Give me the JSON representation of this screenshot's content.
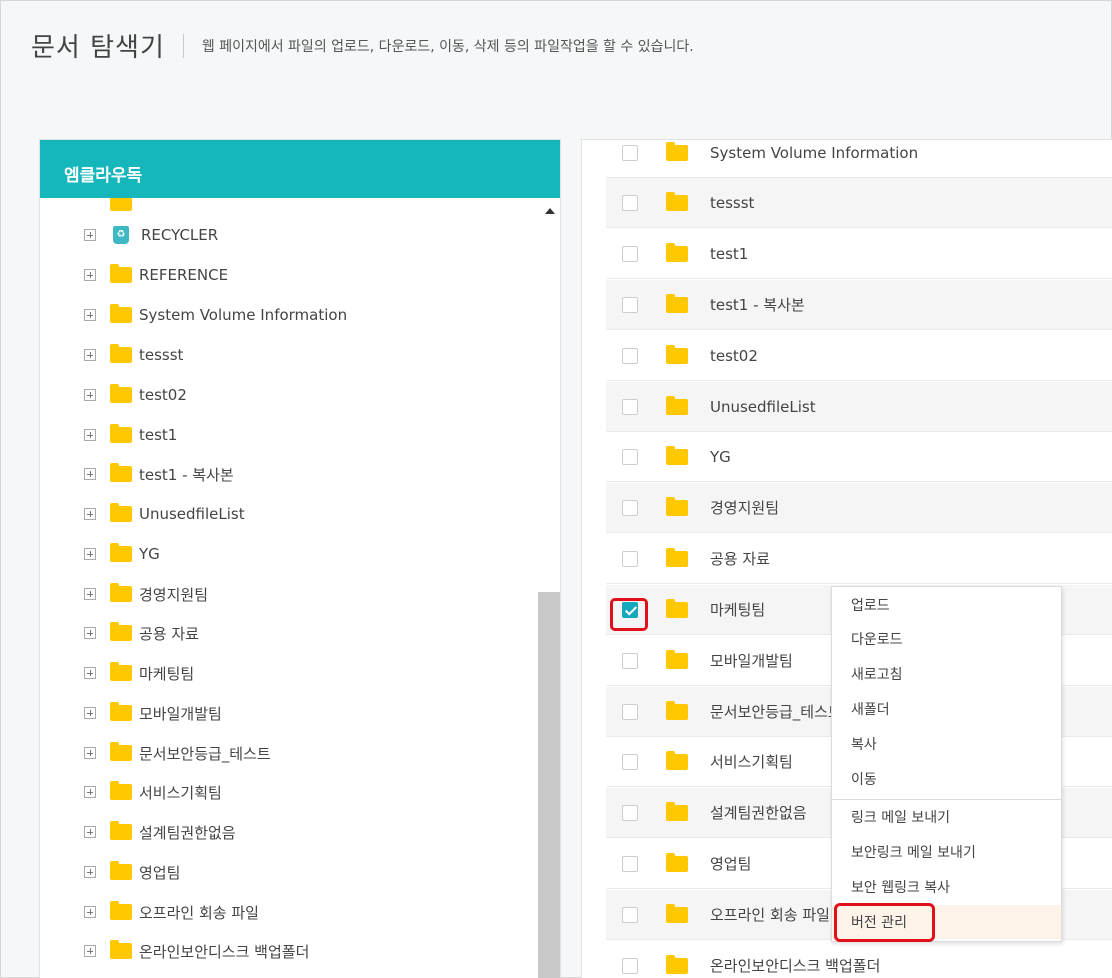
{
  "header": {
    "title": "문서 탐색기",
    "description": "웹 페이지에서 파일의 업로드, 다운로드, 이동, 삭제 등의 파일작업을 할 수 있습니다."
  },
  "tree": {
    "header": "엠클라우독",
    "items": [
      {
        "label": "RECYCLER",
        "icon": "recycle-bin-icon"
      },
      {
        "label": "REFERENCE",
        "icon": "folder-icon"
      },
      {
        "label": "System Volume Information",
        "icon": "folder-icon"
      },
      {
        "label": "tessst",
        "icon": "folder-icon"
      },
      {
        "label": "test02",
        "icon": "folder-icon"
      },
      {
        "label": "test1",
        "icon": "folder-icon"
      },
      {
        "label": "test1 - 복사본",
        "icon": "folder-icon"
      },
      {
        "label": "UnusedfileList",
        "icon": "folder-icon"
      },
      {
        "label": "YG",
        "icon": "folder-icon"
      },
      {
        "label": "경영지원팀",
        "icon": "folder-icon"
      },
      {
        "label": "공용 자료",
        "icon": "folder-icon"
      },
      {
        "label": "마케팅팀",
        "icon": "folder-icon"
      },
      {
        "label": "모바일개발팀",
        "icon": "folder-icon"
      },
      {
        "label": "문서보안등급_테스트",
        "icon": "folder-icon"
      },
      {
        "label": "서비스기획팀",
        "icon": "folder-icon"
      },
      {
        "label": "설계팀권한없음",
        "icon": "folder-icon"
      },
      {
        "label": "영업팀",
        "icon": "folder-icon"
      },
      {
        "label": "오프라인 회송 파일",
        "icon": "folder-icon"
      },
      {
        "label": "온라인보안디스크 백업폴더",
        "icon": "folder-icon"
      }
    ]
  },
  "list": {
    "rows": [
      {
        "label": "System Volume Information",
        "checked": false
      },
      {
        "label": "tessst",
        "checked": false
      },
      {
        "label": "test1",
        "checked": false
      },
      {
        "label": "test1 - 복사본",
        "checked": false
      },
      {
        "label": "test02",
        "checked": false
      },
      {
        "label": "UnusedfileList",
        "checked": false
      },
      {
        "label": "YG",
        "checked": false
      },
      {
        "label": "경영지원팀",
        "checked": false
      },
      {
        "label": "공용 자료",
        "checked": false
      },
      {
        "label": "마케팅팀",
        "checked": true
      },
      {
        "label": "모바일개발팀",
        "checked": false
      },
      {
        "label": "문서보안등급_테스트",
        "checked": false
      },
      {
        "label": "서비스기획팀",
        "checked": false
      },
      {
        "label": "설계팀권한없음",
        "checked": false
      },
      {
        "label": "영업팀",
        "checked": false
      },
      {
        "label": "오프라인 회송 파일",
        "checked": false
      },
      {
        "label": "온라인보안디스크 백업폴더",
        "checked": false
      }
    ]
  },
  "context_menu": {
    "items": [
      {
        "label": "업로드"
      },
      {
        "label": "다운로드"
      },
      {
        "label": "새로고침"
      },
      {
        "label": "새폴더"
      },
      {
        "label": "복사"
      },
      {
        "label": "이동"
      },
      {
        "label": "링크 메일 보내기"
      },
      {
        "label": "보안링크 메일 보내기"
      },
      {
        "label": "보안 웹링크 복사"
      },
      {
        "label": "버전 관리"
      }
    ],
    "active_item": "버전 관리"
  },
  "colors": {
    "accent": "#16b6bd",
    "folder": "#ffc800",
    "highlight": "#e0101a",
    "checkbox_checked": "#16a8bd"
  }
}
